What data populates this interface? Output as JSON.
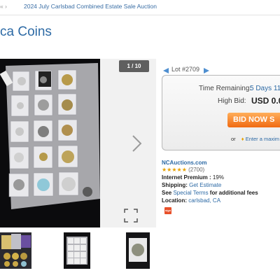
{
  "breadcrumb": {
    "separator": "« ›",
    "sale_link": "2024 July Carlsbad Combined Estate Sale Auction"
  },
  "page_title": "ca Coins",
  "viewer": {
    "counter": "1 / 10"
  },
  "lot": {
    "label": "Lot #2709"
  },
  "bidding": {
    "time_remaining_label": "Time Remaining:",
    "time_remaining_value": "5 Days 11",
    "high_bid_label": "High Bid:",
    "high_bid_value": "USD 0.0",
    "bid_button": "BID NOW S",
    "or_text": "or",
    "max_bid_link": "Enter a maxim"
  },
  "seller": {
    "name": "NCAuctions.com",
    "stars": "★★★★★",
    "rating_count": "(2700)",
    "premium_label": "Internet Premium :",
    "premium_value": "19%",
    "shipping_label": "Shipping:",
    "shipping_link": "Get Estimate",
    "see_text": "See",
    "special_terms_link": "Special Terms",
    "fees_text": "for additional fees",
    "location_label": "Location:",
    "location_value": "carlsbad, CA"
  },
  "badge_text": "sign",
  "colors": {
    "link_blue": "#2d6aa5",
    "bid_orange": "#f06a12",
    "star_gold": "#e7a100",
    "badge_red": "#e8502a"
  }
}
